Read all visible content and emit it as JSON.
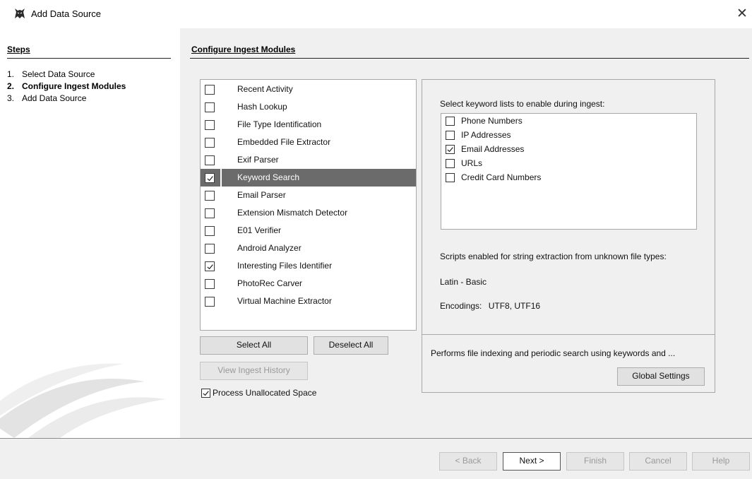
{
  "window": {
    "title": "Add Data Source",
    "app_icon": "autopsy-dog-icon",
    "close_glyph": "✕"
  },
  "steps": {
    "heading": "Steps",
    "items": [
      {
        "num": "1.",
        "label": "Select Data Source",
        "active": false
      },
      {
        "num": "2.",
        "label": "Configure Ingest Modules",
        "active": true
      },
      {
        "num": "3.",
        "label": "Add Data Source",
        "active": false
      }
    ]
  },
  "main": {
    "heading": "Configure Ingest Modules"
  },
  "modules": [
    {
      "label": "Recent Activity",
      "checked": false,
      "selected": false
    },
    {
      "label": "Hash Lookup",
      "checked": false,
      "selected": false
    },
    {
      "label": "File Type Identification",
      "checked": false,
      "selected": false
    },
    {
      "label": "Embedded File Extractor",
      "checked": false,
      "selected": false
    },
    {
      "label": "Exif Parser",
      "checked": false,
      "selected": false
    },
    {
      "label": "Keyword Search",
      "checked": true,
      "selected": true
    },
    {
      "label": "Email Parser",
      "checked": false,
      "selected": false
    },
    {
      "label": "Extension Mismatch Detector",
      "checked": false,
      "selected": false
    },
    {
      "label": "E01 Verifier",
      "checked": false,
      "selected": false
    },
    {
      "label": "Android Analyzer",
      "checked": false,
      "selected": false
    },
    {
      "label": "Interesting Files Identifier",
      "checked": true,
      "selected": false
    },
    {
      "label": "PhotoRec Carver",
      "checked": false,
      "selected": false
    },
    {
      "label": "Virtual Machine Extractor",
      "checked": false,
      "selected": false
    }
  ],
  "module_buttons": {
    "select_all": "Select All",
    "deselect_all": "Deselect All",
    "view_history": "View Ingest History"
  },
  "unallocated": {
    "label": "Process Unallocated Space",
    "checked": true
  },
  "keyword_settings": {
    "heading": "Select keyword lists to enable during ingest:",
    "lists": [
      {
        "label": "Phone Numbers",
        "checked": false
      },
      {
        "label": "IP Addresses",
        "checked": false
      },
      {
        "label": "Email Addresses",
        "checked": true
      },
      {
        "label": "URLs",
        "checked": false
      },
      {
        "label": "Credit Card Numbers",
        "checked": false
      }
    ],
    "scripts_label": "Scripts enabled for string extraction from unknown file types:",
    "scripts_value": "Latin - Basic",
    "encodings_label": "Encodings:",
    "encodings_value": "UTF8, UTF16",
    "description": "Performs file indexing and periodic search using keywords and ...",
    "global_settings": "Global Settings"
  },
  "footer": {
    "back": "< Back",
    "next": "Next >",
    "finish": "Finish",
    "cancel": "Cancel",
    "help": "Help"
  },
  "colors": {
    "selected_row": "#6b6b6b",
    "panel_bg": "#f0f0f0",
    "disabled_text": "#9a9a9a"
  }
}
